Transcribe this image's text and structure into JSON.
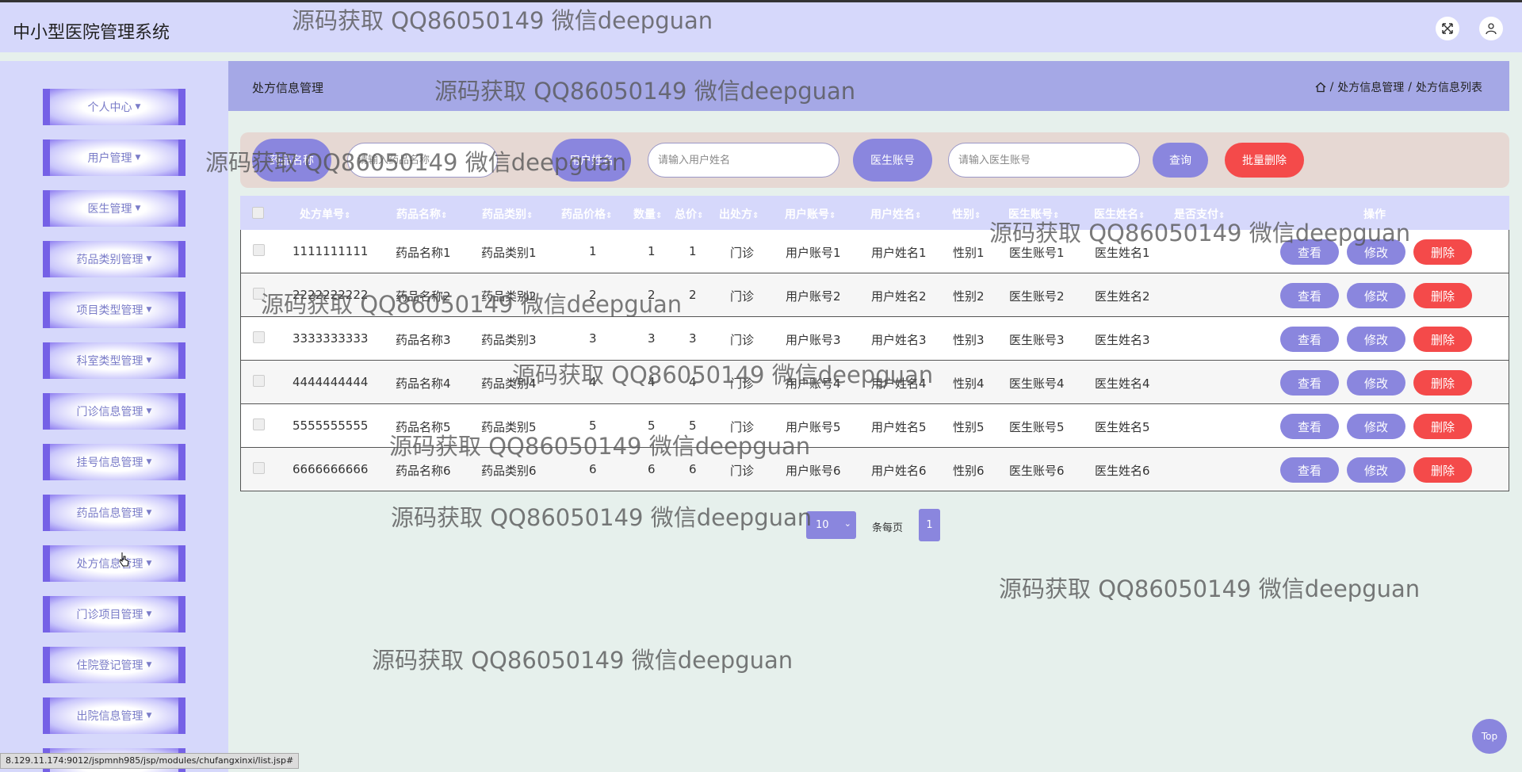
{
  "app": {
    "title": "中小型医院管理系统"
  },
  "header": {
    "fullscreen_icon": "expand-icon",
    "user_icon": "user-icon"
  },
  "sidebar": {
    "items": [
      {
        "label": "个人中心"
      },
      {
        "label": "用户管理"
      },
      {
        "label": "医生管理"
      },
      {
        "label": "药品类别管理"
      },
      {
        "label": "项目类型管理"
      },
      {
        "label": "科室类型管理"
      },
      {
        "label": "门诊信息管理"
      },
      {
        "label": "挂号信息管理"
      },
      {
        "label": "药品信息管理"
      },
      {
        "label": "处方信息管理"
      },
      {
        "label": "门诊项目管理"
      },
      {
        "label": "住院登记管理"
      },
      {
        "label": "出院信息管理"
      }
    ]
  },
  "page": {
    "title": "处方信息管理",
    "breadcrumb": [
      "处方信息管理",
      "处方信息列表"
    ],
    "breadcrumb_sep": "/"
  },
  "search": {
    "label1": "药品名称",
    "placeholder1": "请输入药品名称",
    "label2": "用户姓名",
    "placeholder2": "请输入用户姓名",
    "label3": "医生账号",
    "placeholder3": "请输入医生账号",
    "query_label": "查询",
    "batch_delete_label": "批量删除"
  },
  "table": {
    "headers": [
      "处方单号",
      "药品名称",
      "药品类别",
      "药品价格",
      "数量",
      "总价",
      "出处方",
      "用户账号",
      "用户姓名",
      "性别",
      "医生账号",
      "医生姓名",
      "是否支付",
      "操作"
    ],
    "sort_glyph": "⇕",
    "rows": [
      [
        "1111111111",
        "药品名称1",
        "药品类别1",
        "1",
        "1",
        "1",
        "门诊",
        "用户账号1",
        "用户姓名1",
        "性别1",
        "医生账号1",
        "医生姓名1"
      ],
      [
        "2222222222",
        "药品名称2",
        "药品类别2",
        "2",
        "2",
        "2",
        "门诊",
        "用户账号2",
        "用户姓名2",
        "性别2",
        "医生账号2",
        "医生姓名2"
      ],
      [
        "3333333333",
        "药品名称3",
        "药品类别3",
        "3",
        "3",
        "3",
        "门诊",
        "用户账号3",
        "用户姓名3",
        "性别3",
        "医生账号3",
        "医生姓名3"
      ],
      [
        "4444444444",
        "药品名称4",
        "药品类别4",
        "4",
        "4",
        "4",
        "门诊",
        "用户账号4",
        "用户姓名4",
        "性别4",
        "医生账号4",
        "医生姓名4"
      ],
      [
        "5555555555",
        "药品名称5",
        "药品类别5",
        "5",
        "5",
        "5",
        "门诊",
        "用户账号5",
        "用户姓名5",
        "性别5",
        "医生账号5",
        "医生姓名5"
      ],
      [
        "6666666666",
        "药品名称6",
        "药品类别6",
        "6",
        "6",
        "6",
        "门诊",
        "用户账号6",
        "用户姓名6",
        "性别6",
        "医生账号6",
        "医生姓名6"
      ]
    ],
    "actions": {
      "view": "查看",
      "edit": "修改",
      "delete": "删除"
    }
  },
  "pagination": {
    "page_size": "10",
    "per_page_text": "条每页",
    "current_page": "1"
  },
  "watermark": "源码获取 QQ86050149 微信deepguan",
  "status_url": "8.129.11.174:9012/jspmnh985/jsp/modules/chufangxinxi/list.jsp#",
  "back_to_top": "Top",
  "colors": {
    "accent": "#8a86de",
    "danger": "#f44a4a",
    "sidebar_bg": "#d6d8fb",
    "head_band": "#a5a8e6"
  }
}
